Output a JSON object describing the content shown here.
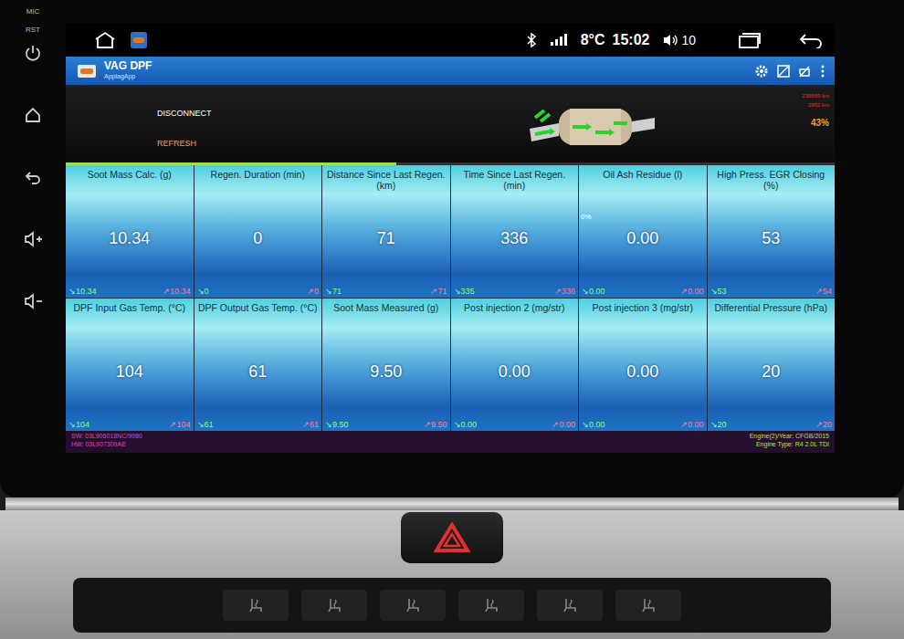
{
  "head_unit": {
    "labels": [
      "MIC",
      "RST"
    ]
  },
  "status_bar": {
    "temperature": "8°C",
    "time": "15:02",
    "volume": "10"
  },
  "app": {
    "title": "VAG DPF",
    "subtitle": "ApplagApp",
    "buttons": [
      "DISCONNECT",
      "REFRESH"
    ],
    "info": [
      "236665 km",
      "2952 km"
    ],
    "progress": {
      "reading": "43%",
      "level": 0.43
    }
  },
  "tiles": [
    {
      "title": "Soot Mass Calc. (g)",
      "value": "10.34",
      "min": "↘10.34",
      "max": "↗10.34"
    },
    {
      "title": "Regen. Duration (min)",
      "value": "0",
      "min": "↘0",
      "max": "↗0"
    },
    {
      "title": "Distance Since Last Regen. (km)",
      "value": "71",
      "min": "↘71",
      "max": "↗71"
    },
    {
      "title": "Time Since Last Regen. (min)",
      "value": "336",
      "min": "↘335",
      "max": "↗336"
    },
    {
      "title": "Oil Ash Residue (l)",
      "value": "0.00",
      "min": "↘0.00",
      "max": "↗0.00",
      "badge": "0%"
    },
    {
      "title": "High Press. EGR Closing (%)",
      "value": "53",
      "min": "↘53",
      "max": "↗54"
    },
    {
      "title": "DPF Input Gas Temp. (°C)",
      "value": "104",
      "min": "↘104",
      "max": "↗104"
    },
    {
      "title": "DPF Output Gas Temp. (°C)",
      "value": "61",
      "min": "↘61",
      "max": "↗61"
    },
    {
      "title": "Soot Mass Measured (g)",
      "value": "9.50",
      "min": "↘9.50",
      "max": "↗9.50"
    },
    {
      "title": "Post injection 2 (mg/str)",
      "value": "0.00",
      "min": "↘0.00",
      "max": "↗0.00"
    },
    {
      "title": "Post injection 3 (mg/str)",
      "value": "0.00",
      "min": "↘0.00",
      "max": "↗0.00"
    },
    {
      "title": "Differential Pressure (hPa)",
      "value": "20",
      "min": "↘20",
      "max": "↗20"
    }
  ],
  "footer": {
    "left": [
      "SW: 03L906018NC/9980",
      "HW: 03L907309AE"
    ],
    "right": [
      "Engine(2)/Year: CFGB/2015",
      "Engine Type: R4 2.0L TDI"
    ]
  }
}
